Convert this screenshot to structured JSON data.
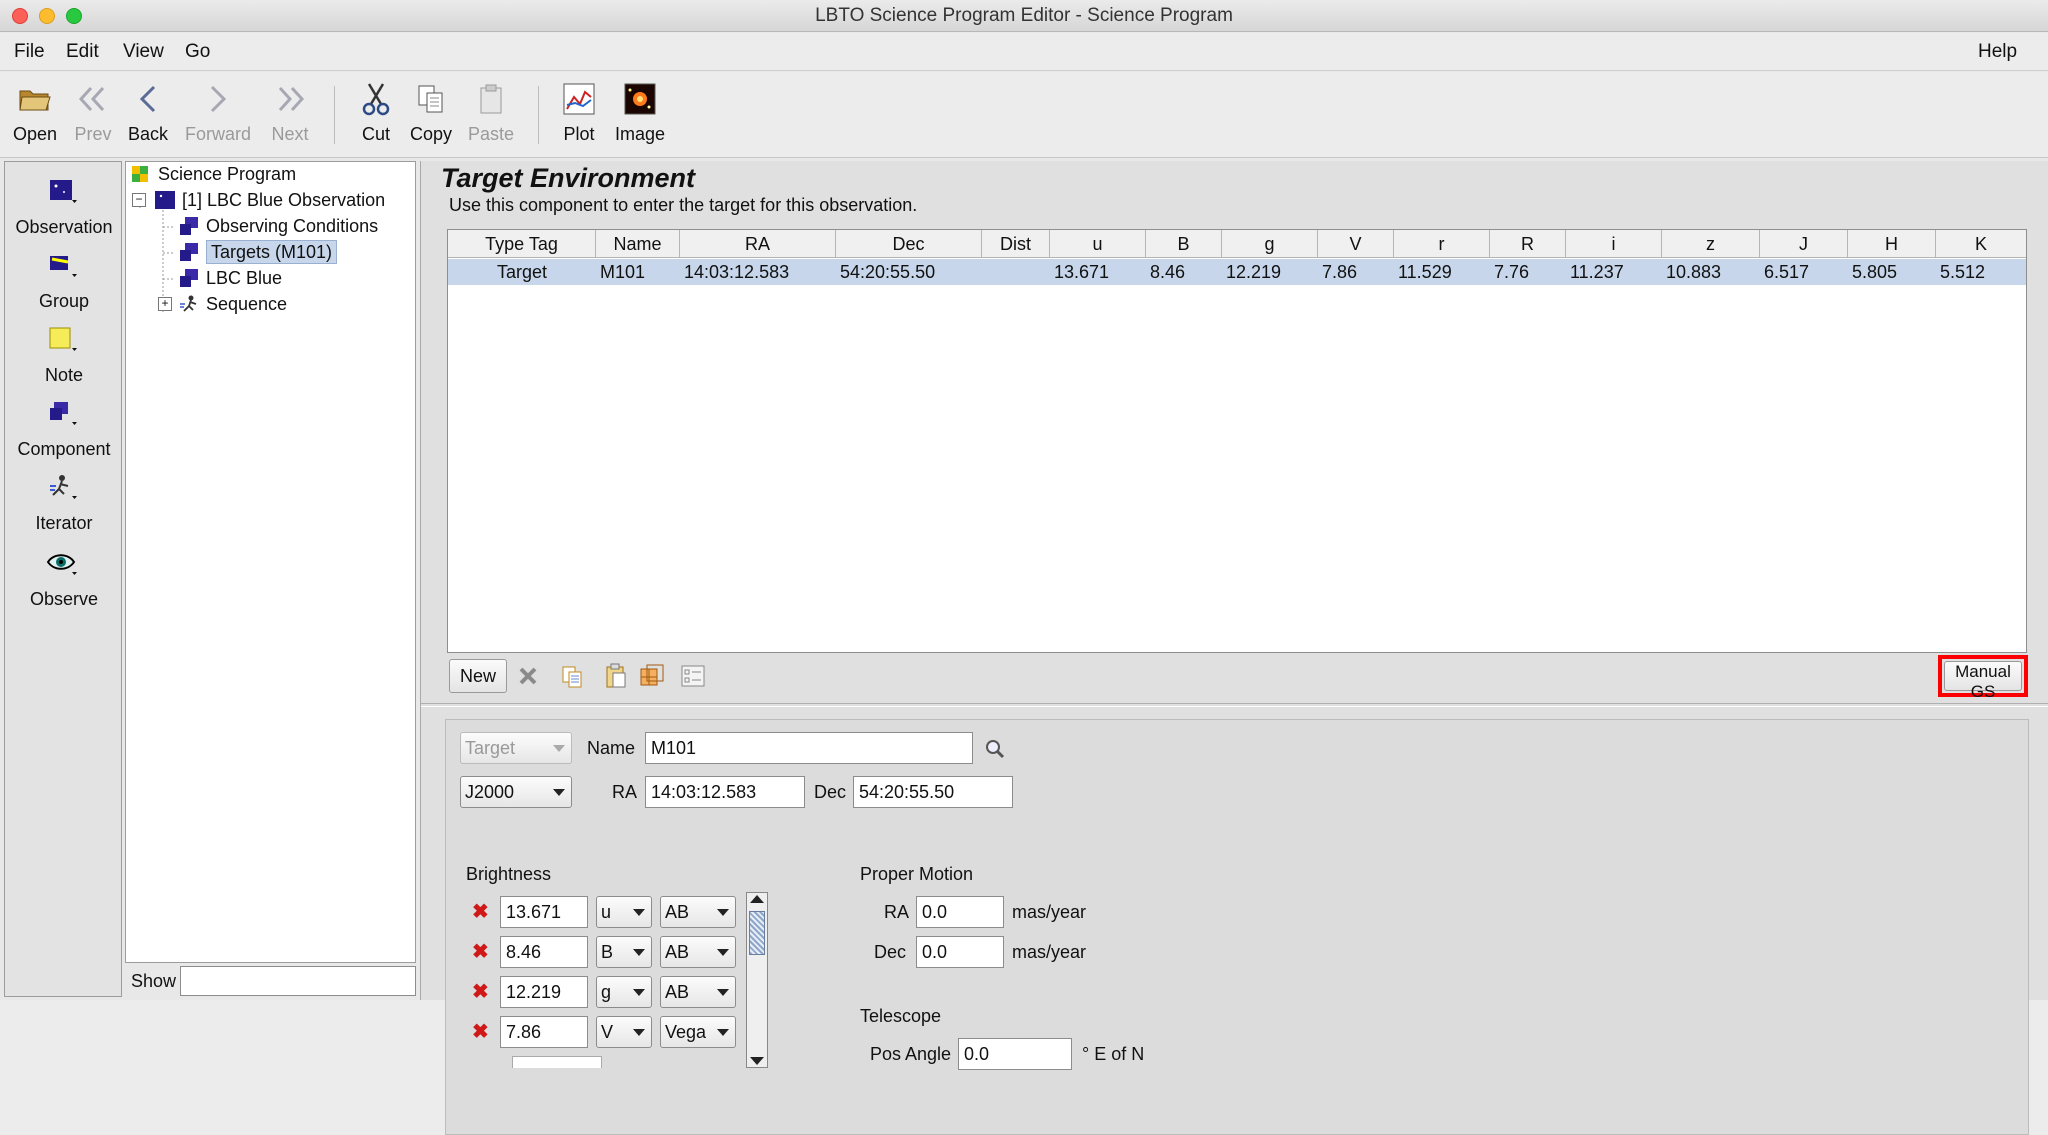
{
  "window": {
    "title": "LBTO Science Program Editor - Science Program"
  },
  "menu": {
    "file": "File",
    "edit": "Edit",
    "view": "View",
    "go": "Go",
    "help": "Help"
  },
  "toolbar": {
    "open": "Open",
    "prev": "Prev",
    "back": "Back",
    "forward": "Forward",
    "next": "Next",
    "cut": "Cut",
    "copy": "Copy",
    "paste": "Paste",
    "plot": "Plot",
    "image": "Image"
  },
  "palette": {
    "observation": "Observation",
    "group": "Group",
    "note": "Note",
    "component": "Component",
    "iterator": "Iterator",
    "observe": "Observe"
  },
  "tree": {
    "root": "Science Program",
    "observation": "[1] LBC Blue Observation",
    "conditions": "Observing Conditions",
    "targets": "Targets (M101)",
    "instrument": "LBC Blue",
    "sequence": "Sequence"
  },
  "show": {
    "label": "Show",
    "value": ""
  },
  "target_env": {
    "title": "Target Environment",
    "subtitle": "Use this component to enter the target for this observation.",
    "columns": [
      "Type Tag",
      "Name",
      "RA",
      "Dec",
      "Dist",
      "u",
      "B",
      "g",
      "V",
      "r",
      "R",
      "i",
      "z",
      "J",
      "H",
      "K"
    ],
    "row": [
      "Target",
      "M101",
      "14:03:12.583",
      "54:20:55.50",
      "",
      "13.671",
      "8.46",
      "12.219",
      "7.86",
      "11.529",
      "7.76",
      "11.237",
      "10.883",
      "6.517",
      "5.805",
      "5.512"
    ],
    "new_button": "New",
    "manual_gs_button": "Manual GS"
  },
  "editor": {
    "type_value": "Target",
    "name_label": "Name",
    "name_value": "M101",
    "system_value": "J2000",
    "ra_label": "RA",
    "ra_value": "14:03:12.583",
    "dec_label": "Dec",
    "dec_value": "54:20:55.50",
    "brightness_label": "Brightness",
    "brightness": [
      {
        "value": "13.671",
        "band": "u",
        "system": "AB"
      },
      {
        "value": "8.46",
        "band": "B",
        "system": "AB"
      },
      {
        "value": "12.219",
        "band": "g",
        "system": "AB"
      },
      {
        "value": "7.86",
        "band": "V",
        "system": "Vega"
      }
    ],
    "proper_motion_label": "Proper Motion",
    "pm_ra_label": "RA",
    "pm_ra_value": "0.0",
    "pm_dec_label": "Dec",
    "pm_dec_value": "0.0",
    "pm_unit": "mas/year",
    "telescope_label": "Telescope",
    "pos_angle_label": "Pos Angle",
    "pos_angle_value": "0.0",
    "pos_angle_unit": "° E of N"
  },
  "colors": {
    "highlight": "#ff0000",
    "selection": "#c7d6ea"
  }
}
